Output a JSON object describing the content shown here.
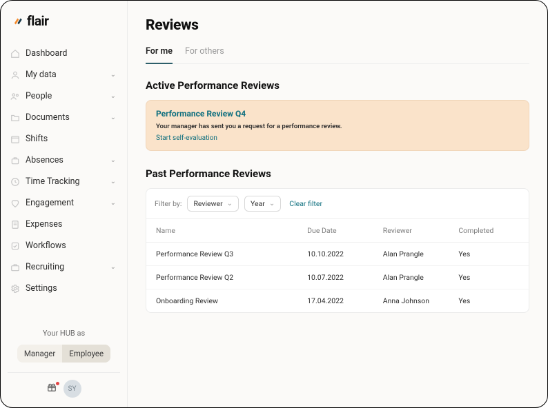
{
  "logo": {
    "text": "flair"
  },
  "sidebar": {
    "items": [
      {
        "label": "Dashboard",
        "expandable": false
      },
      {
        "label": "My data",
        "expandable": true
      },
      {
        "label": "People",
        "expandable": true
      },
      {
        "label": "Documents",
        "expandable": true
      },
      {
        "label": "Shifts",
        "expandable": false
      },
      {
        "label": "Absences",
        "expandable": true
      },
      {
        "label": "Time Tracking",
        "expandable": true
      },
      {
        "label": "Engagement",
        "expandable": true
      },
      {
        "label": "Expenses",
        "expandable": false
      },
      {
        "label": "Workflows",
        "expandable": false
      },
      {
        "label": "Recruiting",
        "expandable": true
      },
      {
        "label": "Settings",
        "expandable": false
      }
    ]
  },
  "hub": {
    "label": "Your HUB as",
    "optionA": "Manager",
    "optionB": "Employee"
  },
  "footer": {
    "avatarInitials": "SY"
  },
  "page": {
    "title": "Reviews"
  },
  "tabs": {
    "forMe": "For me",
    "forOthers": "For others"
  },
  "active": {
    "title": "Active Performance Reviews",
    "card": {
      "title": "Performance Review Q4",
      "desc": "Your manager has sent you a request for a performance review.",
      "action": "Start self-evaluation"
    }
  },
  "past": {
    "title": "Past Performance Reviews",
    "filterLabel": "Filter by:",
    "filterReviewer": "Reviewer",
    "filterYear": "Year",
    "clear": "Clear filter",
    "columns": {
      "name": "Name",
      "dueDate": "Due Date",
      "reviewer": "Reviewer",
      "completed": "Completed"
    },
    "rows": [
      {
        "name": "Performance Review Q3",
        "dueDate": "10.10.2022",
        "reviewer": "Alan Prangle",
        "completed": "Yes"
      },
      {
        "name": "Performance Review Q2",
        "dueDate": "10.07.2022",
        "reviewer": "Alan Prangle",
        "completed": "Yes"
      },
      {
        "name": "Onboarding Review",
        "dueDate": "17.04.2022",
        "reviewer": "Anna Johnson",
        "completed": "Yes"
      }
    ]
  }
}
